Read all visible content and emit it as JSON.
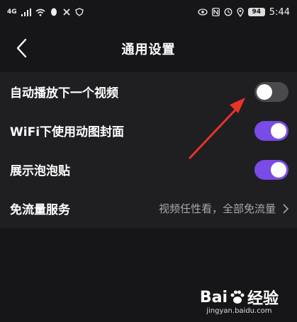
{
  "status_bar": {
    "left_network": "4G",
    "time": "5:44",
    "battery": "94"
  },
  "header": {
    "title": "通用设置"
  },
  "settings": [
    {
      "label": "自动播放下一个视频",
      "state": "off"
    },
    {
      "label": "WiFi下使用动图封面",
      "state": "on"
    },
    {
      "label": "展示泡泡贴",
      "state": "on"
    }
  ],
  "service": {
    "label": "免流量服务",
    "value": "视频任性看，全部免流量"
  },
  "watermark": {
    "brand_left": "Bai",
    "brand_right": "经验",
    "url": "jingyan.baidu.com"
  },
  "colors": {
    "accent": "#7a4be6",
    "toggle_off": "#4a4a4d",
    "annotation_arrow": "#e8332b"
  },
  "icons": [
    "back-chevron-icon",
    "chevron-right-icon",
    "eye-icon",
    "nfc-icon",
    "alarm-icon",
    "location-icon",
    "wifi-icon",
    "signal-icon"
  ]
}
